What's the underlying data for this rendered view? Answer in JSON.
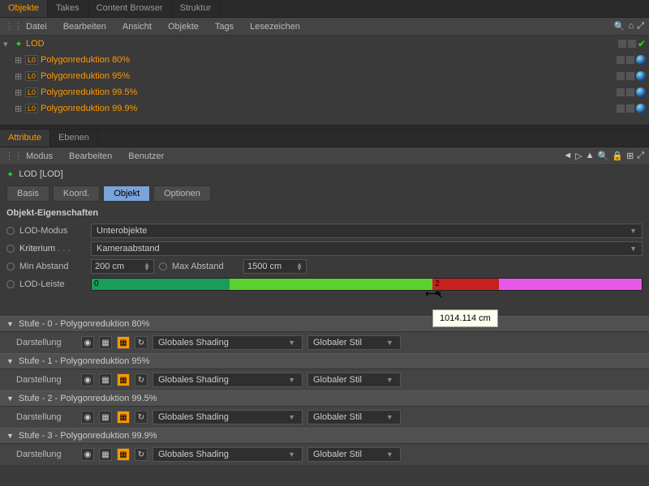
{
  "top_tabs": [
    "Objekte",
    "Takes",
    "Content Browser",
    "Struktur"
  ],
  "top_active": 0,
  "obj_menu": [
    "Datei",
    "Bearbeiten",
    "Ansicht",
    "Objekte",
    "Tags",
    "Lesezeichen"
  ],
  "tree": {
    "root": "LOD",
    "children": [
      "Polygonreduktion 80%",
      "Polygonreduktion 95%",
      "Polygonreduktion 99.5%",
      "Polygonreduktion 99.9%"
    ],
    "lod_badge": "L0"
  },
  "attr_tabs": [
    "Attribute",
    "Ebenen"
  ],
  "attr_active": 0,
  "attr_menu": [
    "Modus",
    "Bearbeiten",
    "Benutzer"
  ],
  "crumb": "LOD [LOD]",
  "subtabs": [
    "Basis",
    "Koord.",
    "Objekt",
    "Optionen"
  ],
  "subtab_active": 2,
  "section": "Objekt-Eigenschaften",
  "props": {
    "lod_modus_label": "LOD-Modus",
    "lod_modus_value": "Unterobjekte",
    "kriterium_label": "Kriterium",
    "kriterium_value": "Kameraabstand",
    "min_abstand_label": "Min Abstand",
    "min_abstand_value": "200 cm",
    "max_abstand_label": "Max Abstand",
    "max_abstand_value": "1500 cm",
    "lod_leiste_label": "LOD-Leiste"
  },
  "lod_bar": {
    "segments": [
      {
        "label": "0",
        "color": "#1a9c5a",
        "width": 25
      },
      {
        "label": "",
        "color": "#5cd12f",
        "width": 37
      },
      {
        "label": "2",
        "color": "#c82020",
        "width": 12
      },
      {
        "label": "",
        "color": "#e858e8",
        "width": 26
      }
    ]
  },
  "tooltip": "1014.114 cm",
  "stufen": [
    {
      "title": "Stufe - 0 - Polygonreduktion 80%"
    },
    {
      "title": "Stufe - 1 - Polygonreduktion 95%"
    },
    {
      "title": "Stufe - 2 - Polygonreduktion 99.5%"
    },
    {
      "title": "Stufe - 3 - Polygonreduktion 99.9%"
    }
  ],
  "stufe_body": {
    "darstellung": "Darstellung",
    "shading": "Globales Shading",
    "stil": "Globaler Stil"
  }
}
